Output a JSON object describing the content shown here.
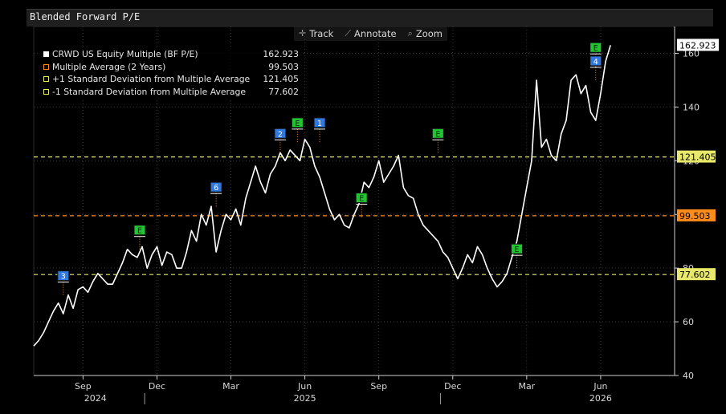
{
  "title": "Blended Forward P/E",
  "toolbar": [
    {
      "label": "Track",
      "icon": "crosshair-icon",
      "glyph": "✛"
    },
    {
      "label": "Annotate",
      "icon": "pencil-icon",
      "glyph": "⟋"
    },
    {
      "label": "Zoom",
      "icon": "magnifier-icon",
      "glyph": "⌕"
    }
  ],
  "colors": {
    "background": "#000000",
    "price": "#ffffff",
    "average": "#ff8c1a",
    "stddev": "#e8e86a",
    "earnings": "#22c432",
    "count": "#2f78e0"
  },
  "legend": [
    {
      "name": "CRWD US Equity Multiple (BF P/E)",
      "value": "162.923",
      "swatch": "solid-white"
    },
    {
      "name": "Multiple Average (2 Years)",
      "value": "99.503",
      "swatch": "orange-box"
    },
    {
      "name": "+1 Standard Deviation from Multiple Average",
      "value": "121.405",
      "swatch": "yellow-box"
    },
    {
      "name": "-1 Standard Deviation from Multiple Average",
      "value": "77.602",
      "swatch": "yellow-box"
    }
  ],
  "chart_data": {
    "type": "line",
    "title": "Blended Forward P/E",
    "ylim": [
      40,
      170
    ],
    "yticks": [
      40,
      60,
      80,
      100,
      120,
      140,
      160
    ],
    "x_month_ticks": [
      "Sep",
      "Dec",
      "Mar",
      "Jun",
      "Sep",
      "Dec",
      "Mar",
      "Jun"
    ],
    "x_month_index": [
      2,
      5,
      8,
      11,
      14,
      17,
      20,
      23
    ],
    "x_year_labels": [
      {
        "label": "2024",
        "month_index": 2.5
      },
      {
        "label": "2025",
        "month_index": 11
      },
      {
        "label": "2026",
        "month_index": 23
      }
    ],
    "x_year_dividers": [
      4.5,
      16.5
    ],
    "x_range_months": [
      0,
      26
    ],
    "series": [
      {
        "name": "CRWD US Equity Multiple (BF P/E)",
        "x_month": [
          0.0,
          0.2,
          0.4,
          0.6,
          0.8,
          1.0,
          1.2,
          1.4,
          1.6,
          1.8,
          2.0,
          2.2,
          2.4,
          2.6,
          2.8,
          3.0,
          3.2,
          3.4,
          3.6,
          3.8,
          4.0,
          4.2,
          4.4,
          4.6,
          4.8,
          5.0,
          5.2,
          5.4,
          5.6,
          5.8,
          6.0,
          6.2,
          6.4,
          6.6,
          6.8,
          7.0,
          7.2,
          7.4,
          7.6,
          7.8,
          8.0,
          8.2,
          8.4,
          8.6,
          8.8,
          9.0,
          9.2,
          9.4,
          9.6,
          9.8,
          10.0,
          10.2,
          10.4,
          10.6,
          10.8,
          11.0,
          11.2,
          11.4,
          11.6,
          11.8,
          12.0,
          12.2,
          12.4,
          12.6,
          12.8,
          13.0,
          13.2,
          13.4,
          13.6,
          13.8,
          14.0,
          14.2,
          14.4,
          14.6,
          14.8,
          15.0,
          15.2,
          15.4,
          15.6,
          15.8,
          16.0,
          16.2,
          16.4,
          16.6,
          16.8,
          17.0,
          17.2,
          17.4,
          17.6,
          17.8,
          18.0,
          18.2,
          18.4,
          18.6,
          18.8,
          19.0,
          19.2,
          19.4,
          19.6,
          19.8,
          20.0,
          20.2,
          20.4,
          20.6,
          20.8,
          21.0,
          21.2,
          21.4,
          21.6,
          21.8,
          22.0,
          22.2,
          22.4,
          22.6,
          22.8,
          23.0,
          23.2,
          23.4,
          23.6,
          23.8,
          24.0,
          24.2,
          24.4,
          24.6,
          24.8,
          25.0,
          25.2,
          25.4,
          25.6
        ],
        "values": [
          51,
          53,
          56,
          60,
          64,
          67,
          63,
          70,
          65,
          72,
          73,
          71,
          75,
          78,
          76,
          74,
          74,
          78,
          82,
          87,
          85,
          84,
          88,
          80,
          85,
          88,
          81,
          86,
          85,
          80,
          80,
          86,
          94,
          90,
          100,
          96,
          103,
          86,
          94,
          100,
          98,
          102,
          96,
          106,
          112,
          118,
          112,
          108,
          115,
          118,
          123,
          120,
          124,
          122,
          120,
          128,
          125,
          118,
          114,
          108,
          102,
          98,
          100,
          96,
          95,
          100,
          104,
          112,
          110,
          114,
          120,
          112,
          115,
          118,
          122,
          110,
          107,
          106,
          100,
          96,
          94,
          92,
          90,
          86,
          84,
          80,
          76,
          80,
          85,
          82,
          88,
          85,
          80,
          76,
          73,
          75,
          78,
          84,
          90,
          100,
          110,
          120,
          150,
          125,
          128,
          122,
          120,
          130,
          135,
          150,
          152,
          145,
          148,
          138,
          135,
          145,
          157,
          163
        ],
        "color": "#ffffff"
      }
    ],
    "reference_lines": [
      {
        "name": "+1 Standard Deviation from Multiple Average",
        "value": 121.405,
        "label": "121.405",
        "color": "#e8e86a",
        "dash": true
      },
      {
        "name": "Multiple Average (2 Years)",
        "value": 99.503,
        "label": "99.503",
        "color": "#ff8c1a",
        "dash": true
      },
      {
        "name": "-1 Standard Deviation from Multiple Average",
        "value": 77.602,
        "label": "77.602",
        "color": "#e8e86a",
        "dash": true
      }
    ],
    "last_value_label": "162.923",
    "events": [
      {
        "type": "count",
        "label": "3",
        "x_month": 1.2,
        "y": 70
      },
      {
        "type": "earnings",
        "label": "E",
        "x_month": 4.3,
        "y": 87
      },
      {
        "type": "count",
        "label": "6",
        "x_month": 7.4,
        "y": 103
      },
      {
        "type": "count",
        "label": "2",
        "x_month": 10.0,
        "y": 123
      },
      {
        "type": "earnings",
        "label": "E",
        "x_month": 10.7,
        "y": 127
      },
      {
        "type": "count",
        "label": "1",
        "x_month": 11.6,
        "y": 127
      },
      {
        "type": "earnings",
        "label": "E",
        "x_month": 13.3,
        "y": 99
      },
      {
        "type": "earnings",
        "label": "E",
        "x_month": 16.4,
        "y": 123
      },
      {
        "type": "earnings",
        "label": "E",
        "x_month": 19.6,
        "y": 80
      },
      {
        "type": "earnings",
        "label": "E",
        "x_month": 22.8,
        "y": 155
      },
      {
        "type": "count",
        "label": "4",
        "x_month": 22.8,
        "y": 150
      }
    ]
  }
}
